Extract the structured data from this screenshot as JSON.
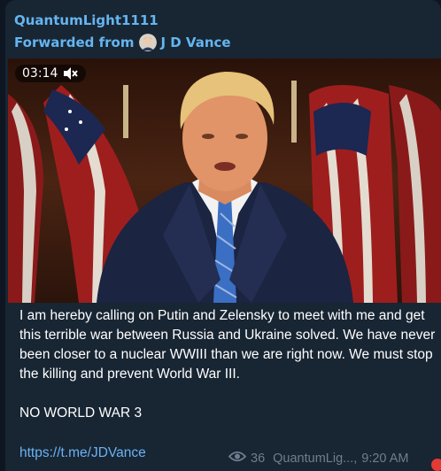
{
  "message": {
    "channel_name": "QuantumLight1111",
    "forwarded_prefix": "Forwarded from",
    "forwarded_name": "J D Vance",
    "video": {
      "duration": "03:14",
      "muted_icon": "speaker-muted-icon"
    },
    "text_paragraph_1": "I am hereby calling on Putin and Zelensky to meet with me and get this terrible war between Russia and Ukraine solved. We have never been closer to a nuclear WWIII than we are right now. We must stop the killing and prevent World War III.",
    "text_paragraph_2": "NO WORLD WAR 3",
    "link": "https://t.me/JDVance",
    "views_icon": "eye-icon",
    "views": "36",
    "author": "QuantumLig...,",
    "time": "9:20 AM"
  },
  "colors": {
    "background": "#0e1621",
    "bubble": "#182533",
    "accent": "#64b5ef",
    "link": "#6ab3f3",
    "meta": "#6d7f8f"
  }
}
